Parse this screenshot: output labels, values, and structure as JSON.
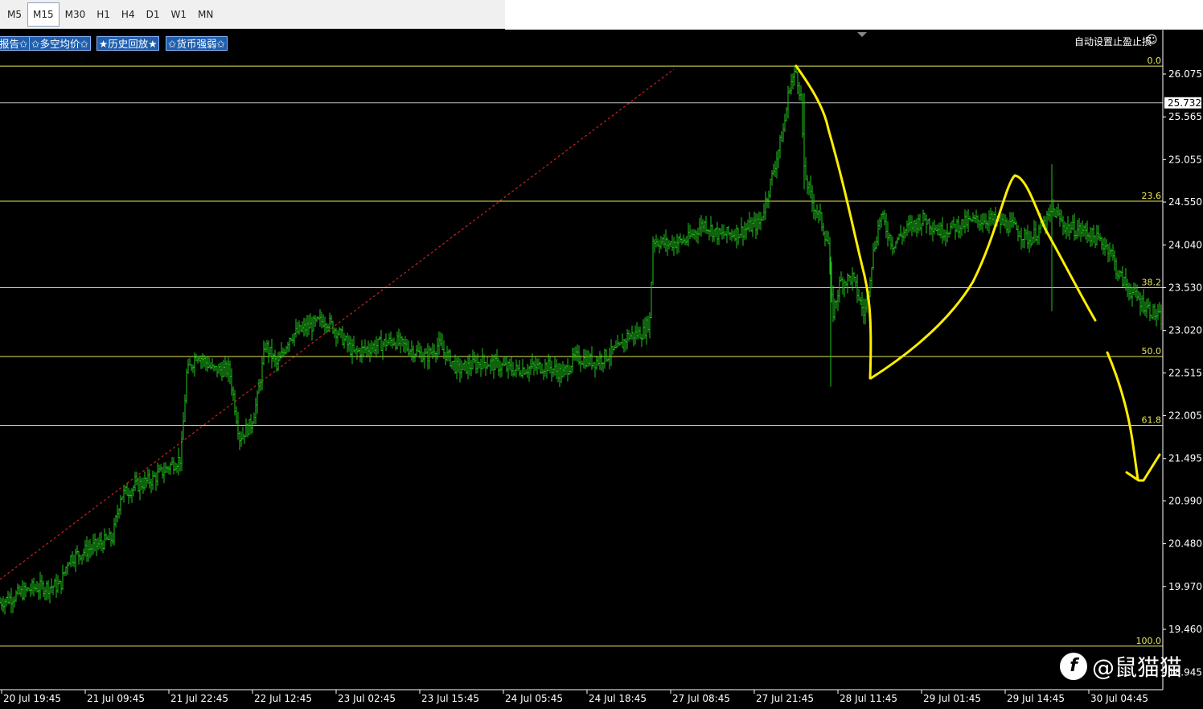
{
  "toolbar": {
    "timeframes": [
      {
        "label": "M5",
        "active": false
      },
      {
        "label": "M15",
        "active": true
      },
      {
        "label": "M30",
        "active": false
      },
      {
        "label": "H1",
        "active": false
      },
      {
        "label": "H4",
        "active": false
      },
      {
        "label": "D1",
        "active": false
      },
      {
        "label": "W1",
        "active": false
      },
      {
        "label": "MN",
        "active": false
      }
    ]
  },
  "chart_buttons": {
    "report": "报告✩",
    "long_short_avg": "✩多空均价✩",
    "history_replay": "★历史回放★",
    "currency_strength": "✩货币强弱✩"
  },
  "auto_stop_label": "自动设置止盈止损",
  "smiley": "☺",
  "watermark": {
    "logo": "f",
    "text": "@鼠猫猫"
  },
  "colors": {
    "background": "#000000",
    "bars": "#22c41c",
    "fib_lines": "#e6e65a",
    "fib_labels": "#e6e65a",
    "hline": "#c0c0c0",
    "trendline": "#cc2222",
    "annotation": "#ffee00",
    "axis_text": "#ffffff"
  },
  "chart_data": {
    "type": "ohlc",
    "timeframe": "M15",
    "ylim": [
      19.1,
      26.35
    ],
    "y_ticks": [
      "26.075",
      "25.565",
      "25.055",
      "24.550",
      "24.040",
      "23.530",
      "23.020",
      "22.515",
      "22.005",
      "21.495",
      "20.990",
      "20.480",
      "19.970",
      "19.460",
      "18.945"
    ],
    "y_tick_values": [
      26.075,
      25.565,
      25.055,
      24.55,
      24.04,
      23.53,
      23.02,
      22.515,
      22.005,
      21.495,
      20.99,
      20.48,
      19.97,
      19.46,
      18.945
    ],
    "x_ticks": [
      "20 Jul 19:45",
      "21 Jul 09:45",
      "21 Jul 22:45",
      "22 Jul 12:45",
      "23 Jul 02:45",
      "23 Jul 15:45",
      "24 Jul 05:45",
      "24 Jul 18:45",
      "27 Jul 08:45",
      "27 Jul 21:45",
      "28 Jul 11:45",
      "29 Jul 01:45",
      "29 Jul 14:45",
      "30 Jul 04:45"
    ],
    "current_price": "25.732",
    "fibonacci": [
      {
        "level": "0.0",
        "price": 26.17
      },
      {
        "level": "23.6",
        "price": 24.56
      },
      {
        "level": "38.2",
        "price": 23.53
      },
      {
        "level": "50.0",
        "price": 22.71
      },
      {
        "level": "61.8",
        "price": 21.89
      },
      {
        "level": "100.0",
        "price": 19.26
      }
    ],
    "close_path": [
      [
        0,
        19.78
      ],
      [
        40,
        19.95
      ],
      [
        75,
        19.98
      ],
      [
        85,
        20.3
      ],
      [
        140,
        20.55
      ],
      [
        150,
        21.05
      ],
      [
        165,
        21.15
      ],
      [
        190,
        21.25
      ],
      [
        210,
        21.4
      ],
      [
        225,
        21.5
      ],
      [
        232,
        22.5
      ],
      [
        245,
        22.75
      ],
      [
        265,
        22.55
      ],
      [
        285,
        22.55
      ],
      [
        298,
        21.75
      ],
      [
        312,
        21.9
      ],
      [
        320,
        22.2
      ],
      [
        330,
        22.85
      ],
      [
        345,
        22.6
      ],
      [
        360,
        22.95
      ],
      [
        380,
        23.05
      ],
      [
        405,
        23.15
      ],
      [
        420,
        23.0
      ],
      [
        440,
        22.75
      ],
      [
        470,
        22.85
      ],
      [
        490,
        22.9
      ],
      [
        510,
        22.8
      ],
      [
        530,
        22.7
      ],
      [
        545,
        22.85
      ],
      [
        570,
        22.55
      ],
      [
        600,
        22.65
      ],
      [
        640,
        22.55
      ],
      [
        680,
        22.6
      ],
      [
        700,
        22.5
      ],
      [
        715,
        22.7
      ],
      [
        740,
        22.65
      ],
      [
        770,
        22.8
      ],
      [
        780,
        22.95
      ],
      [
        800,
        23.0
      ],
      [
        808,
        23.15
      ],
      [
        812,
        24.1
      ],
      [
        830,
        24.05
      ],
      [
        855,
        24.1
      ],
      [
        875,
        24.3
      ],
      [
        895,
        24.15
      ],
      [
        920,
        24.2
      ],
      [
        945,
        24.3
      ],
      [
        960,
        24.85
      ],
      [
        975,
        25.45
      ],
      [
        982,
        25.95
      ],
      [
        990,
        26.1
      ],
      [
        996,
        25.8
      ],
      [
        1000,
        24.9
      ],
      [
        1010,
        24.55
      ],
      [
        1020,
        24.35
      ],
      [
        1030,
        24.05
      ],
      [
        1035,
        23.2
      ],
      [
        1045,
        23.6
      ],
      [
        1060,
        23.65
      ],
      [
        1075,
        23.2
      ],
      [
        1085,
        23.9
      ],
      [
        1095,
        24.4
      ],
      [
        1110,
        24.05
      ],
      [
        1130,
        24.25
      ],
      [
        1150,
        24.35
      ],
      [
        1170,
        24.2
      ],
      [
        1200,
        24.3
      ],
      [
        1230,
        24.35
      ],
      [
        1260,
        24.25
      ],
      [
        1280,
        24.1
      ],
      [
        1300,
        24.3
      ],
      [
        1310,
        24.45
      ],
      [
        1325,
        24.25
      ],
      [
        1350,
        24.2
      ],
      [
        1380,
        24.0
      ],
      [
        1390,
        23.7
      ],
      [
        1405,
        23.5
      ],
      [
        1420,
        23.35
      ],
      [
        1444,
        23.15
      ]
    ],
    "annotations": [
      {
        "type": "hand-drawn-path",
        "color": "yellow",
        "description": "falling-stroke"
      },
      {
        "type": "hand-drawn-path",
        "color": "yellow",
        "description": "peak-stroke"
      },
      {
        "type": "hand-drawn-arrow",
        "color": "yellow",
        "description": "down-arrow"
      }
    ]
  }
}
